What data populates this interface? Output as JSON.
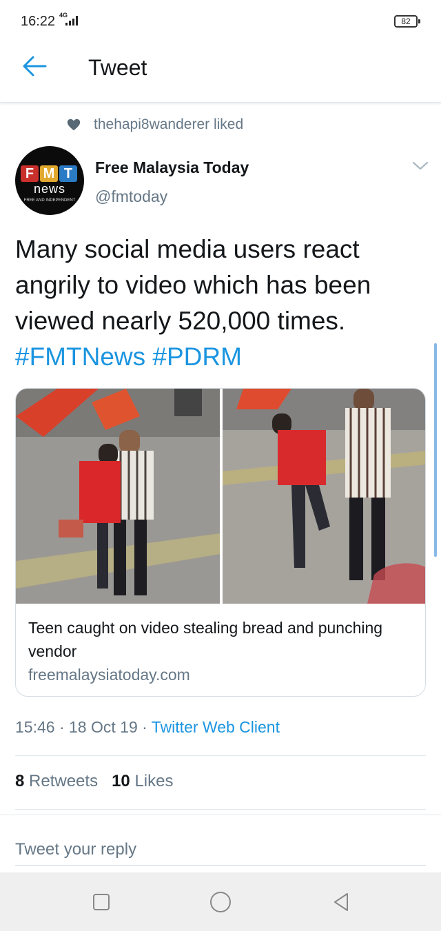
{
  "status_bar": {
    "time": "16:22",
    "network": "4G",
    "battery": "82"
  },
  "header": {
    "title": "Tweet"
  },
  "social_context": {
    "text": "thehapi8wanderer liked"
  },
  "author": {
    "name": "Free Malaysia Today",
    "handle": "@fmtoday",
    "avatar": {
      "letters": [
        "F",
        "M",
        "T"
      ],
      "word": "news",
      "tagline": "FREE AND INDEPENDENT"
    }
  },
  "tweet": {
    "text": "Many social media users react angrily to video which has been viewed nearly 520,000 times.",
    "hashtags": [
      "#FMTNews",
      "#PDRM"
    ]
  },
  "card": {
    "title": "Teen caught on video stealing bread and punching vendor",
    "domain": "freemalaysiatoday.com"
  },
  "meta": {
    "time": "15:46",
    "sep": "·",
    "date": "18 Oct 19",
    "client": "Twitter Web Client"
  },
  "stats": {
    "retweets_count": "8",
    "retweets_label": "Retweets",
    "likes_count": "10",
    "likes_label": "Likes"
  },
  "reply": {
    "placeholder": "Tweet your reply"
  },
  "colors": {
    "accent": "#1b95e0",
    "secondary_text": "#657786",
    "primary_text": "#14171a",
    "divider": "#e1e8ed"
  },
  "icons": {
    "back": "arrow-left-icon",
    "heart": "heart-icon",
    "caret": "chevron-down-icon",
    "nav_recent": "square-icon",
    "nav_home": "circle-icon",
    "nav_back": "triangle-back-icon"
  }
}
